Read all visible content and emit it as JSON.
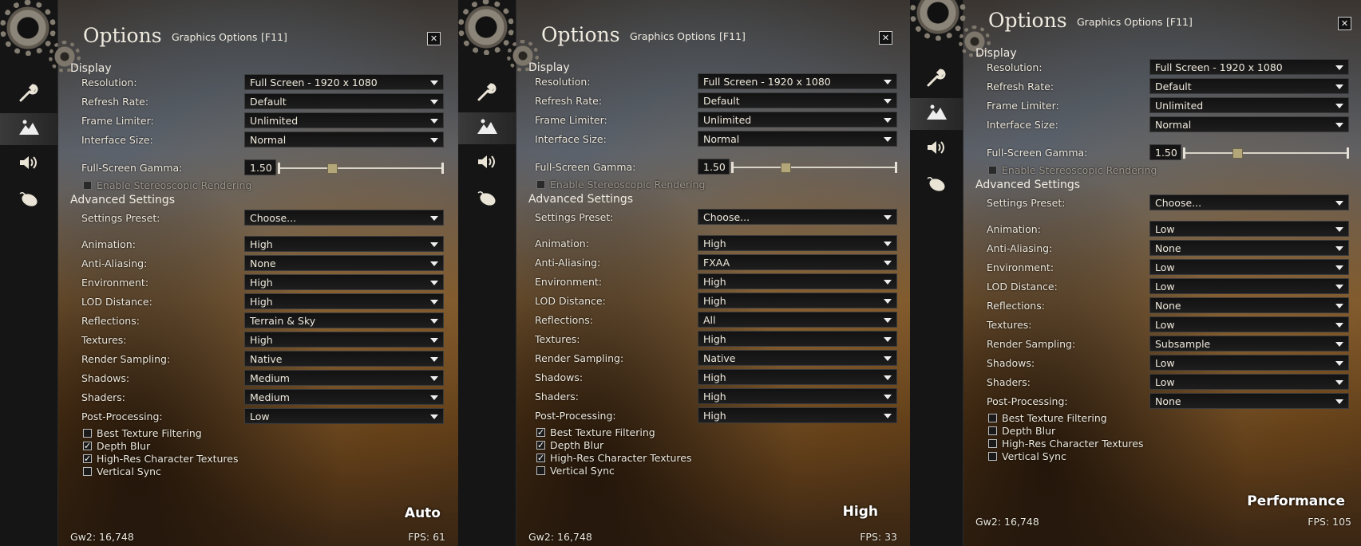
{
  "window": {
    "title": "Options",
    "tab": "Graphics Options",
    "hotkey": "[F11]",
    "close": "✕"
  },
  "sections": {
    "display": "Display",
    "advanced": "Advanced Settings"
  },
  "labels": {
    "resolution": "Resolution:",
    "refresh_rate": "Refresh Rate:",
    "frame_limiter": "Frame Limiter:",
    "interface_size": "Interface Size:",
    "gamma": "Full-Screen Gamma:",
    "stereo": "Enable Stereoscopic Rendering",
    "preset": "Settings Preset:",
    "animation": "Animation:",
    "anti_aliasing": "Anti-Aliasing:",
    "environment": "Environment:",
    "lod": "LOD Distance:",
    "reflections": "Reflections:",
    "textures": "Textures:",
    "render_sampling": "Render Sampling:",
    "shadows": "Shadows:",
    "shaders": "Shaders:",
    "post_processing": "Post-Processing:",
    "best_texture": "Best Texture Filtering",
    "depth_blur": "Depth Blur",
    "highres_char": "High-Res Character Textures",
    "vsync": "Vertical Sync"
  },
  "panels": [
    {
      "display": {
        "resolution": "Full Screen - 1920 x 1080",
        "refresh_rate": "Default",
        "frame_limiter": "Unlimited",
        "interface_size": "Normal",
        "gamma": "1.50"
      },
      "advanced": {
        "preset": "Choose...",
        "animation": "High",
        "anti_aliasing": "None",
        "environment": "High",
        "lod": "High",
        "reflections": "Terrain & Sky",
        "textures": "High",
        "render_sampling": "Native",
        "shadows": "Medium",
        "shaders": "Medium",
        "post_processing": "Low"
      },
      "checks": {
        "best_texture": false,
        "depth_blur": true,
        "highres_char": true,
        "vsync": false
      },
      "preset_name": "Auto",
      "footer_left": "Gw2: 16,748",
      "footer_right": "FPS: 61"
    },
    {
      "display": {
        "resolution": "Full Screen - 1920 x 1080",
        "refresh_rate": "Default",
        "frame_limiter": "Unlimited",
        "interface_size": "Normal",
        "gamma": "1.50"
      },
      "advanced": {
        "preset": "Choose...",
        "animation": "High",
        "anti_aliasing": "FXAA",
        "environment": "High",
        "lod": "High",
        "reflections": "All",
        "textures": "High",
        "render_sampling": "Native",
        "shadows": "High",
        "shaders": "High",
        "post_processing": "High"
      },
      "checks": {
        "best_texture": true,
        "depth_blur": true,
        "highres_char": true,
        "vsync": false
      },
      "preset_name": "High",
      "footer_left": "Gw2: 16,748",
      "footer_right": "FPS: 33"
    },
    {
      "display": {
        "resolution": "Full Screen - 1920 x 1080",
        "refresh_rate": "Default",
        "frame_limiter": "Unlimited",
        "interface_size": "Normal",
        "gamma": "1.50"
      },
      "advanced": {
        "preset": "Choose...",
        "animation": "Low",
        "anti_aliasing": "None",
        "environment": "Low",
        "lod": "Low",
        "reflections": "None",
        "textures": "Low",
        "render_sampling": "Subsample",
        "shadows": "Low",
        "shaders": "Low",
        "post_processing": "None"
      },
      "checks": {
        "best_texture": false,
        "depth_blur": false,
        "highres_char": false,
        "vsync": false
      },
      "preset_name": "Performance",
      "footer_left": "Gw2: 16,748",
      "footer_right": "FPS: 105"
    }
  ],
  "gamma_level": 0.3,
  "checkmark": "✓",
  "icons": {
    "settings": "wrench-icon",
    "graphics": "mountains-icon",
    "audio": "speaker-icon",
    "controls": "mouse-icon"
  }
}
